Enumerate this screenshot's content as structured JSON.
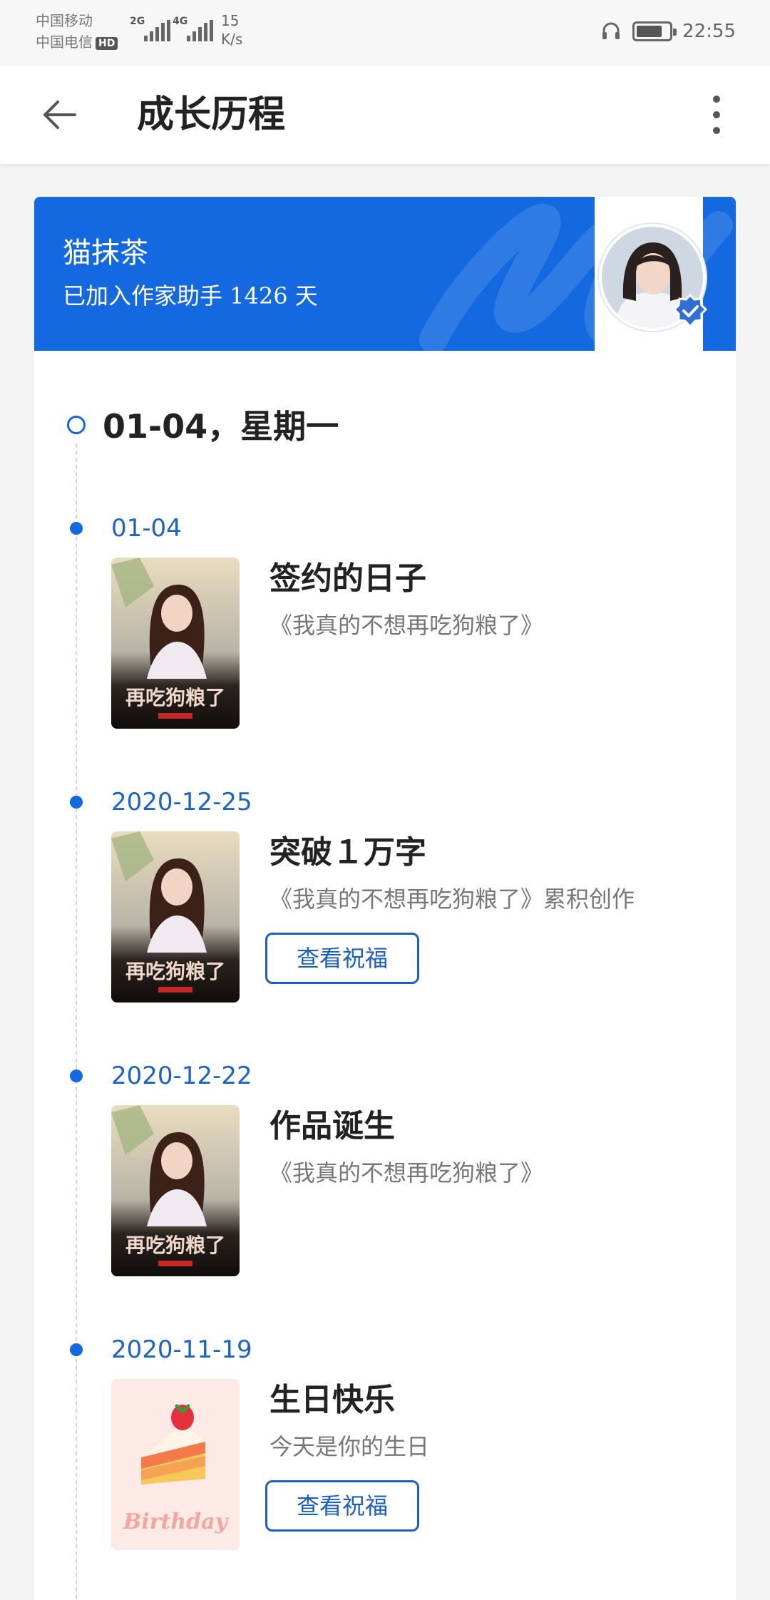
{
  "status_bar": {
    "carrier1": "中国移动",
    "carrier2": "中国电信",
    "hd_badge": "HD",
    "sig1_label": "2G",
    "sig2_label": "4G",
    "net_speed_value": "15",
    "net_speed_unit": "K/s",
    "time": "22:55",
    "battery_level_fraction": 0.8
  },
  "app_bar": {
    "title": "成长历程",
    "back_icon": "arrow-left-icon",
    "more_icon": "more-vertical-icon"
  },
  "banner": {
    "user_name": "猫抹茶",
    "joined_text": "已加入作家助手 1426 天",
    "bg_color": "#1468e0"
  },
  "timeline": {
    "header": "01-04，星期一",
    "entries": [
      {
        "date": "01-04",
        "title": "签约的日子",
        "desc": "《我真的不想再吃狗粮了》",
        "cover": "book-cover",
        "cover_text": "再吃狗粮了"
      },
      {
        "date": "2020-12-25",
        "title": "突破１万字",
        "desc": "《我真的不想再吃狗粮了》累积创作",
        "cover": "book-cover",
        "cover_text": "再吃狗粮了",
        "button": "查看祝福"
      },
      {
        "date": "2020-12-22",
        "title": "作品诞生",
        "desc": "《我真的不想再吃狗粮了》",
        "cover": "book-cover",
        "cover_text": "再吃狗粮了"
      },
      {
        "date": "2020-11-19",
        "title": "生日快乐",
        "desc": "今天是你的生日",
        "cover": "birthday-cake",
        "cover_text": "Birthday",
        "button": "查看祝福"
      }
    ]
  },
  "accent_color": "#1468e0"
}
